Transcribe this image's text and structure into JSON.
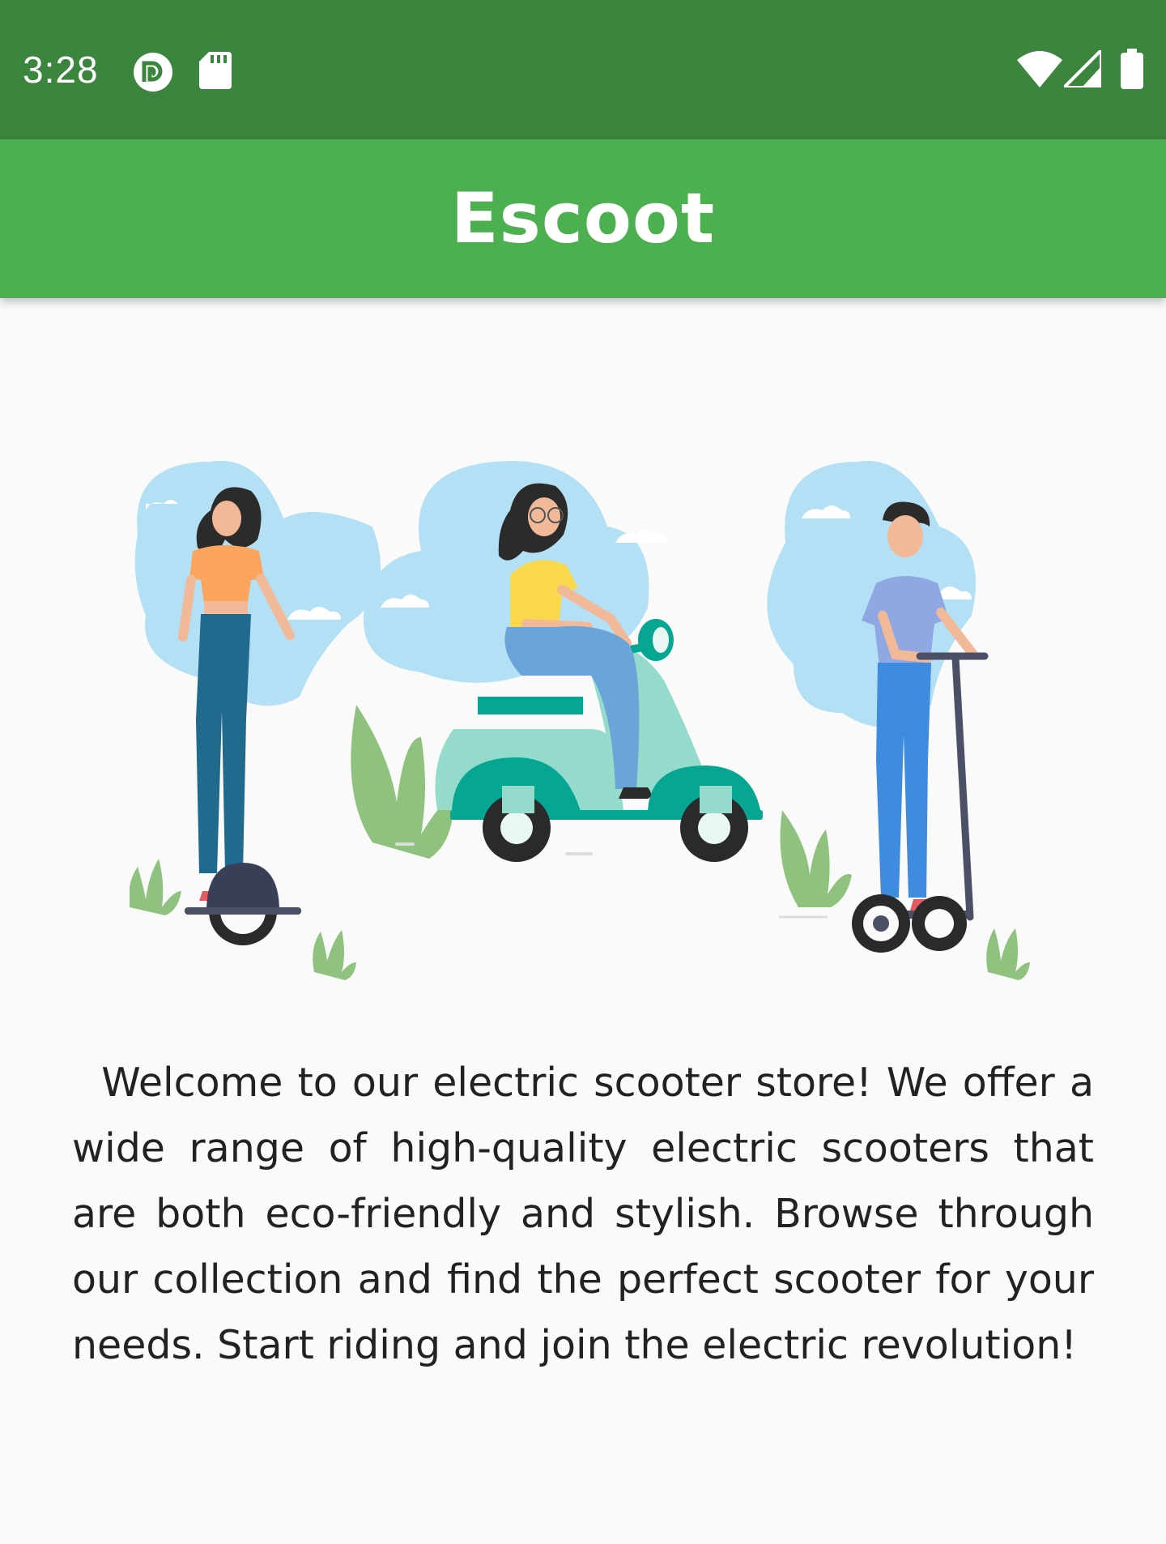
{
  "status_bar": {
    "time": "3:28",
    "left_icons": [
      "pocket-casts-icon",
      "sd-card-icon"
    ],
    "right_icons": [
      "wifi-icon",
      "signal-icon",
      "battery-icon"
    ]
  },
  "app_bar": {
    "title": "Escoot",
    "background": "#4caf50"
  },
  "hero": {
    "illustration": "people-riding-electric-scooters-illustration"
  },
  "welcome": {
    "text": "  Welcome to our electric scooter store! We offer a wide range of high-quality electric scooters that are both eco-friendly and stylish. Browse through our collection and find the perfect scooter for your needs. Start riding and join the electric revolution!"
  },
  "colors": {
    "status_bar": "#3b853e",
    "app_bar": "#4caf50",
    "background": "#fafafa",
    "text": "#222222"
  }
}
